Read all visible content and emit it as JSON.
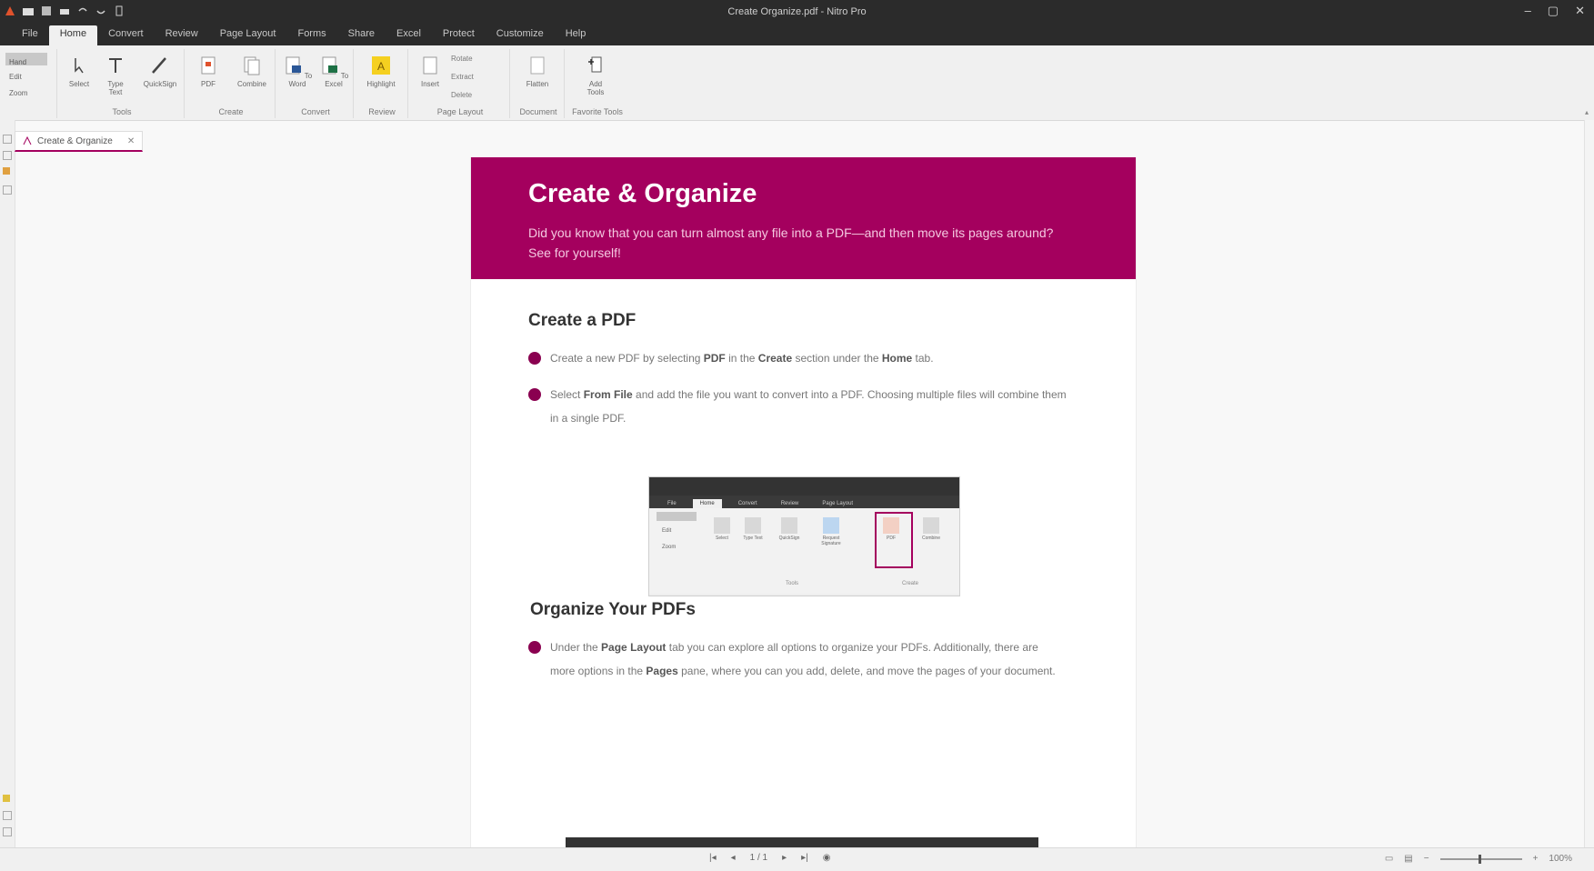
{
  "window": {
    "title": "Create Organize.pdf - Nitro Pro",
    "controls": [
      "–",
      "▢",
      "✕"
    ]
  },
  "menu": {
    "tabs": [
      "File",
      "Home",
      "Convert",
      "Review",
      "Page Layout",
      "Forms",
      "Share",
      "Excel",
      "Protect",
      "Customize",
      "Help"
    ],
    "active": "Home"
  },
  "ribbon": {
    "groups": [
      {
        "label": "Tools",
        "buttons": [
          "Select",
          "Type Text",
          "QuickSign"
        ]
      },
      {
        "label": "Create",
        "buttons": [
          "PDF",
          "Combine"
        ]
      },
      {
        "label": "Convert",
        "buttons": [
          "To Word",
          "To Excel"
        ]
      },
      {
        "label": "Review",
        "buttons": [
          "Highlight"
        ]
      },
      {
        "label": "Page Layout",
        "buttons": [
          "Insert",
          "Rotate",
          "Extract",
          "Delete"
        ]
      },
      {
        "label": "Document",
        "buttons": [
          "Flatten"
        ]
      },
      {
        "label": "Favorite Tools",
        "buttons": [
          "Add Tools"
        ]
      }
    ],
    "side": {
      "hand": "Hand",
      "edit": "Edit",
      "zoom": "Zoom"
    }
  },
  "document_tab": {
    "label": "Create & Organize"
  },
  "page": {
    "banner_title": "Create & Organize",
    "banner_text": "Did you know that you can turn almost any file into a PDF—and then move its pages around? See for yourself!",
    "section1_title": "Create a PDF",
    "section1_bullets": [
      {
        "pre": "Create a new PDF by selecting ",
        "b1": "PDF",
        "mid": " in the ",
        "b2": "Create",
        "mid2": " section under the ",
        "b3": "Home",
        "post": " tab."
      },
      {
        "pre": "Select ",
        "b1": "From File",
        "post": " and add the file you want to convert into a PDF. Choosing multiple files will combine them in a single PDF."
      }
    ],
    "section2_title": "Organize Your PDFs",
    "section2_bullet": {
      "pre": "Under the ",
      "b1": "Page Layout",
      "mid": " tab you can explore all options to organize your PDFs. Additionally, there are more options in the ",
      "b2": "Pages",
      "post": " pane, where you can you add, delete, and move the pages of your document."
    }
  },
  "screenshot_embed": {
    "tabs": [
      "File",
      "Home",
      "Convert",
      "Review",
      "Page Layout"
    ],
    "buttons": [
      "Select",
      "Type Text",
      "QuickSign",
      "Request Signature",
      "PDF",
      "Combine"
    ],
    "group_tools": "Tools",
    "group_create": "Create",
    "side": [
      "Edit",
      "Zoom"
    ]
  },
  "status": {
    "page": "1 / 1",
    "zoom": "100%"
  },
  "colors": {
    "accent": "#a4005e",
    "banner_text": "#f4c8e0"
  }
}
